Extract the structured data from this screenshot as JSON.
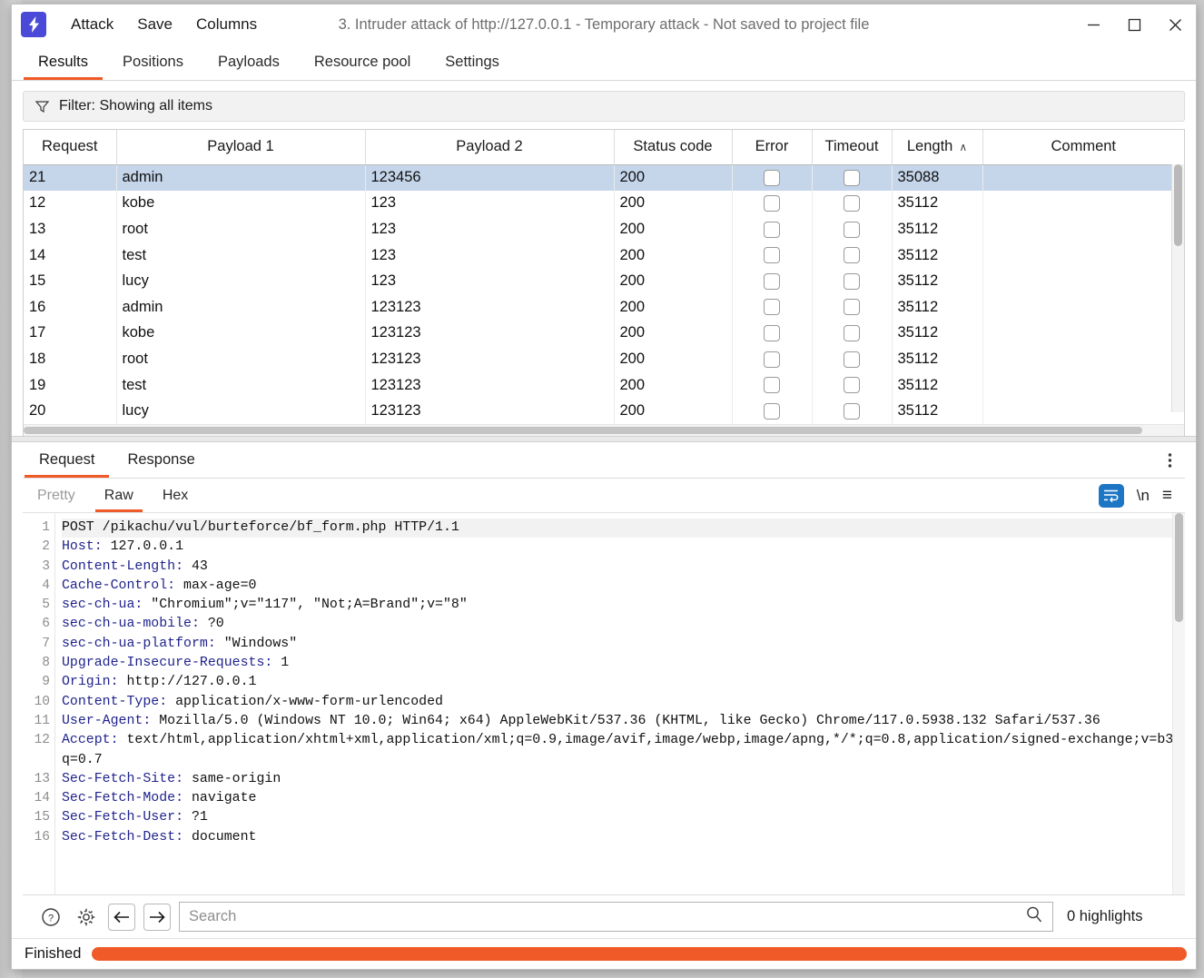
{
  "window": {
    "title": "3. Intruder attack of http://127.0.0.1 - Temporary attack - Not saved to project file",
    "logo_icon": "burp-lightning-icon",
    "menus": [
      {
        "label": "Attack"
      },
      {
        "label": "Save"
      },
      {
        "label": "Columns"
      }
    ],
    "controls": {
      "minimize_icon": "minimize-icon",
      "maximize_icon": "maximize-icon",
      "close_icon": "close-icon"
    }
  },
  "tabs": [
    {
      "label": "Results",
      "active": true
    },
    {
      "label": "Positions",
      "active": false
    },
    {
      "label": "Payloads",
      "active": false
    },
    {
      "label": "Resource pool",
      "active": false
    },
    {
      "label": "Settings",
      "active": false
    }
  ],
  "filter": {
    "icon": "funnel-icon",
    "text": "Filter: Showing all items"
  },
  "results_table": {
    "columns": [
      {
        "key": "request",
        "label": "Request",
        "sorted": false
      },
      {
        "key": "payload1",
        "label": "Payload 1",
        "sorted": false
      },
      {
        "key": "payload2",
        "label": "Payload 2",
        "sorted": false
      },
      {
        "key": "status",
        "label": "Status code",
        "sorted": false
      },
      {
        "key": "error",
        "label": "Error",
        "sorted": false
      },
      {
        "key": "timeout",
        "label": "Timeout",
        "sorted": false
      },
      {
        "key": "length",
        "label": "Length",
        "sorted": true,
        "sort_arrow": "∧"
      },
      {
        "key": "comment",
        "label": "Comment",
        "sorted": false
      }
    ],
    "rows": [
      {
        "request": "21",
        "payload1": "admin",
        "payload2": "123456",
        "status": "200",
        "error": false,
        "timeout": false,
        "length": "35088",
        "comment": "",
        "selected": true
      },
      {
        "request": "12",
        "payload1": "kobe",
        "payload2": "123",
        "status": "200",
        "error": false,
        "timeout": false,
        "length": "35112",
        "comment": "",
        "selected": false
      },
      {
        "request": "13",
        "payload1": "root",
        "payload2": "123",
        "status": "200",
        "error": false,
        "timeout": false,
        "length": "35112",
        "comment": "",
        "selected": false
      },
      {
        "request": "14",
        "payload1": "test",
        "payload2": "123",
        "status": "200",
        "error": false,
        "timeout": false,
        "length": "35112",
        "comment": "",
        "selected": false
      },
      {
        "request": "15",
        "payload1": "lucy",
        "payload2": "123",
        "status": "200",
        "error": false,
        "timeout": false,
        "length": "35112",
        "comment": "",
        "selected": false
      },
      {
        "request": "16",
        "payload1": "admin",
        "payload2": "123123",
        "status": "200",
        "error": false,
        "timeout": false,
        "length": "35112",
        "comment": "",
        "selected": false
      },
      {
        "request": "17",
        "payload1": "kobe",
        "payload2": "123123",
        "status": "200",
        "error": false,
        "timeout": false,
        "length": "35112",
        "comment": "",
        "selected": false
      },
      {
        "request": "18",
        "payload1": "root",
        "payload2": "123123",
        "status": "200",
        "error": false,
        "timeout": false,
        "length": "35112",
        "comment": "",
        "selected": false
      },
      {
        "request": "19",
        "payload1": "test",
        "payload2": "123123",
        "status": "200",
        "error": false,
        "timeout": false,
        "length": "35112",
        "comment": "",
        "selected": false
      },
      {
        "request": "20",
        "payload1": "lucy",
        "payload2": "123123",
        "status": "200",
        "error": false,
        "timeout": false,
        "length": "35112",
        "comment": "",
        "selected": false
      }
    ]
  },
  "message_panel": {
    "tabs": [
      {
        "label": "Request",
        "active": true
      },
      {
        "label": "Response",
        "active": false
      }
    ],
    "overflow_icon": "kebab-menu-icon",
    "view_tabs": [
      {
        "label": "Pretty",
        "active": false,
        "dim": true
      },
      {
        "label": "Raw",
        "active": true,
        "dim": false
      },
      {
        "label": "Hex",
        "active": false,
        "dim": false
      }
    ],
    "view_tools": [
      {
        "icon": "word-wrap-icon",
        "active": true,
        "glyph": "↵"
      },
      {
        "icon": "newline-icon",
        "active": false,
        "glyph": "\\n"
      },
      {
        "icon": "hamburger-menu-icon",
        "active": false,
        "glyph": "≡"
      }
    ],
    "request_lines": [
      {
        "num": "1",
        "text": "POST /pikachu/vul/burteforce/bf_form.php HTTP/1.1",
        "header": false,
        "first": true
      },
      {
        "num": "2",
        "text": "Host: 127.0.0.1",
        "key": "Host:",
        "header": true
      },
      {
        "num": "3",
        "text": "Content-Length: 43",
        "key": "Content-Length:",
        "header": true
      },
      {
        "num": "4",
        "text": "Cache-Control: max-age=0",
        "key": "Cache-Control:",
        "header": true
      },
      {
        "num": "5",
        "text": "sec-ch-ua: \"Chromium\";v=\"117\", \"Not;A=Brand\";v=\"8\"",
        "key": "sec-ch-ua:",
        "header": true
      },
      {
        "num": "6",
        "text": "sec-ch-ua-mobile: ?0",
        "key": "sec-ch-ua-mobile:",
        "header": true
      },
      {
        "num": "7",
        "text": "sec-ch-ua-platform: \"Windows\"",
        "key": "sec-ch-ua-platform:",
        "header": true
      },
      {
        "num": "8",
        "text": "Upgrade-Insecure-Requests: 1",
        "key": "Upgrade-Insecure-Requests:",
        "header": true
      },
      {
        "num": "9",
        "text": "Origin: http://127.0.0.1",
        "key": "Origin:",
        "header": true
      },
      {
        "num": "10",
        "text": "Content-Type: application/x-www-form-urlencoded",
        "key": "Content-Type:",
        "header": true
      },
      {
        "num": "11",
        "text": "User-Agent: Mozilla/5.0 (Windows NT 10.0; Win64; x64) AppleWebKit/537.36 (KHTML, like Gecko) Chrome/117.0.5938.132 Safari/537.36",
        "key": "User-Agent:",
        "header": true
      },
      {
        "num": "12",
        "text": "Accept: text/html,application/xhtml+xml,application/xml;q=0.9,image/avif,image/webp,image/apng,*/*;q=0.8,application/signed-exchange;v=b3;q=0.7",
        "key": "Accept:",
        "header": true
      },
      {
        "num": "13",
        "text": "Sec-Fetch-Site: same-origin",
        "key": "Sec-Fetch-Site:",
        "header": true
      },
      {
        "num": "14",
        "text": "Sec-Fetch-Mode: navigate",
        "key": "Sec-Fetch-Mode:",
        "header": true
      },
      {
        "num": "15",
        "text": "Sec-Fetch-User: ?1",
        "key": "Sec-Fetch-User:",
        "header": true
      },
      {
        "num": "16",
        "text": "Sec-Fetch-Dest: document",
        "key": "Sec-Fetch-Dest:",
        "header": true
      }
    ]
  },
  "search": {
    "help_icon": "help-icon",
    "settings_icon": "gear-icon",
    "prev_icon": "arrow-left-icon",
    "next_icon": "arrow-right-icon",
    "placeholder": "Search",
    "value": "",
    "search_icon": "magnifier-icon",
    "highlights": "0 highlights"
  },
  "status": {
    "text": "Finished",
    "progress_percent": 100,
    "progress_color": "#f05a28"
  },
  "colors": {
    "accent": "#f05a28",
    "selection": "#c5d5ea",
    "header_key": "#20238c",
    "logo": "#4a49d8"
  }
}
